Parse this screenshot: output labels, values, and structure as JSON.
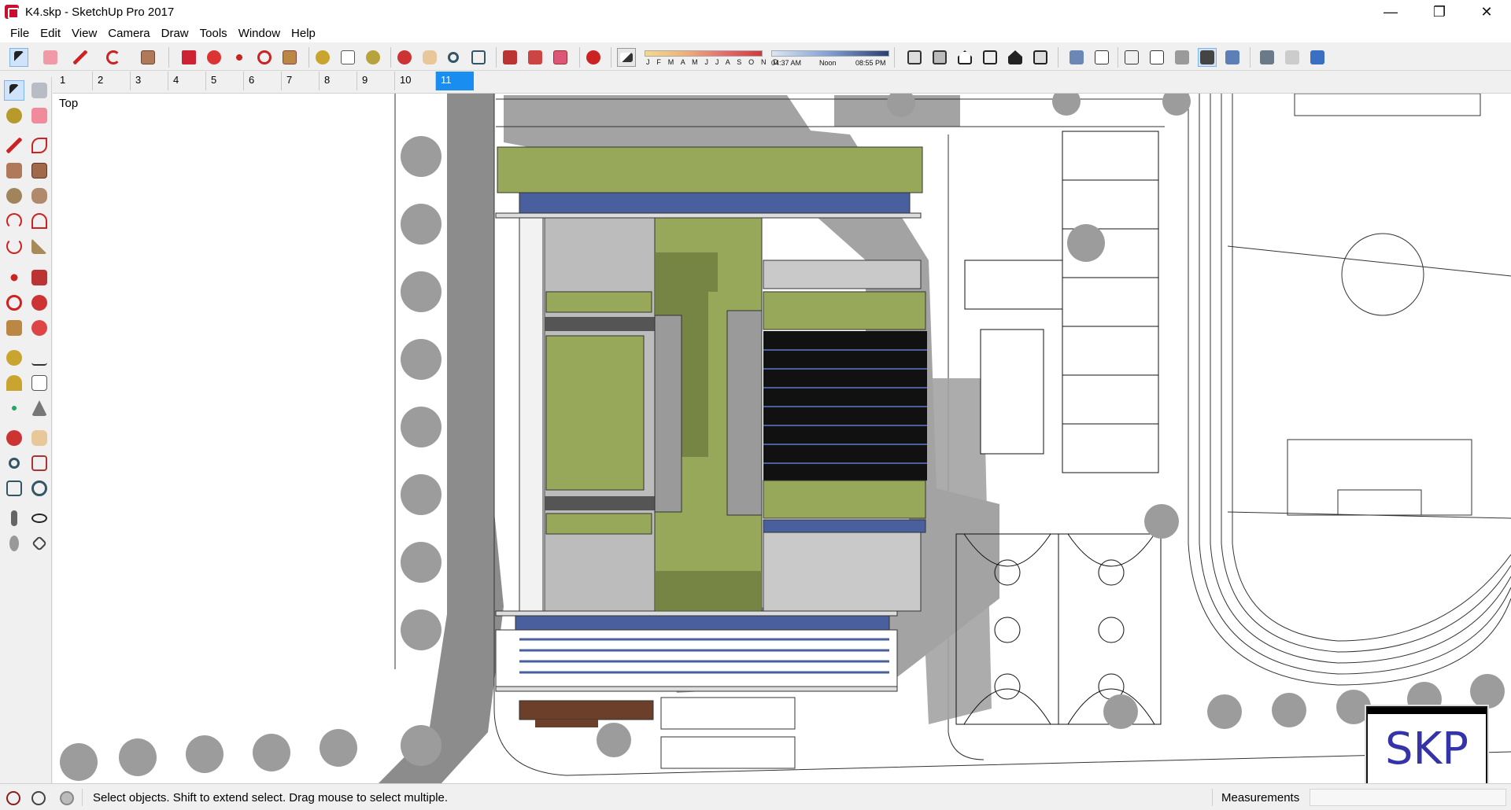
{
  "window": {
    "title": "K4.skp - SketchUp Pro 2017",
    "minimize": "—",
    "restore": "❐",
    "close": "✕"
  },
  "menu": [
    "File",
    "Edit",
    "View",
    "Camera",
    "Draw",
    "Tools",
    "Window",
    "Help"
  ],
  "toolbar": {
    "icons": [
      "select-icon",
      "eraser-icon",
      "line-icon",
      "arc-icon",
      "rectangle-icon",
      "push-pull-icon",
      "follow-me-icon",
      "move-icon",
      "rotate-icon",
      "scale-icon",
      "tape-measure-icon",
      "text-icon",
      "paint-bucket-icon",
      "orbit-icon",
      "pan-icon",
      "zoom-icon",
      "zoom-extents-icon",
      "3d-warehouse-icon",
      "extension-warehouse-icon",
      "layout-icon",
      "extension-manager-icon"
    ],
    "shadow": {
      "months": "J F M A M J J A S O N D",
      "time_start": "04:37 AM",
      "time_mid": "Noon",
      "time_end": "08:55 PM"
    },
    "views": [
      "iso-view-icon",
      "top-view-icon",
      "front-view-icon",
      "right-view-icon",
      "back-view-icon",
      "left-view-icon",
      "xray-style-icon",
      "back-edges-style-icon",
      "wireframe-style-icon",
      "hidden-line-style-icon",
      "shaded-style-icon",
      "shaded-textures-style-icon",
      "monochrome-style-icon",
      "get-models-icon",
      "share-model-icon",
      "share-component-icon"
    ]
  },
  "scenes": [
    "1",
    "2",
    "3",
    "4",
    "5",
    "6",
    "7",
    "8",
    "9",
    "10",
    "11"
  ],
  "active_scene": "11",
  "view_label": "Top",
  "palette": [
    "select-tool",
    "make-component-tool",
    "paint-bucket-tool",
    "eraser-tool",
    "line-tool",
    "freehand-tool",
    "rectangle-tool",
    "rotated-rectangle-tool",
    "circle-tool",
    "polygon-tool",
    "arc-tool",
    "two-point-arc-tool",
    "three-point-arc-tool",
    "pie-tool",
    "move-tool",
    "push-pull-tool",
    "rotate-tool",
    "follow-me-tool",
    "scale-tool",
    "offset-tool",
    "tape-measure-tool",
    "dimension-tool",
    "protractor-tool",
    "text-tool",
    "axes-tool",
    "3d-text-tool",
    "orbit-tool",
    "pan-tool",
    "zoom-tool",
    "zoom-window-tool",
    "zoom-extents-tool",
    "previous-view-tool",
    "position-camera-tool",
    "look-around-tool",
    "walk-tool",
    "section-plane-tool"
  ],
  "logo": "SKP",
  "status": {
    "message": "Select objects. Shift to extend select. Drag mouse to select multiple.",
    "measurements_label": "Measurements",
    "measurements_value": ""
  },
  "colors": {
    "accent": "#1a8ef0",
    "roof_green": "#98a85a",
    "shadow": "#9a9a9a",
    "road": "#8c8c8c",
    "solar_blue": "#4a5f9e"
  }
}
